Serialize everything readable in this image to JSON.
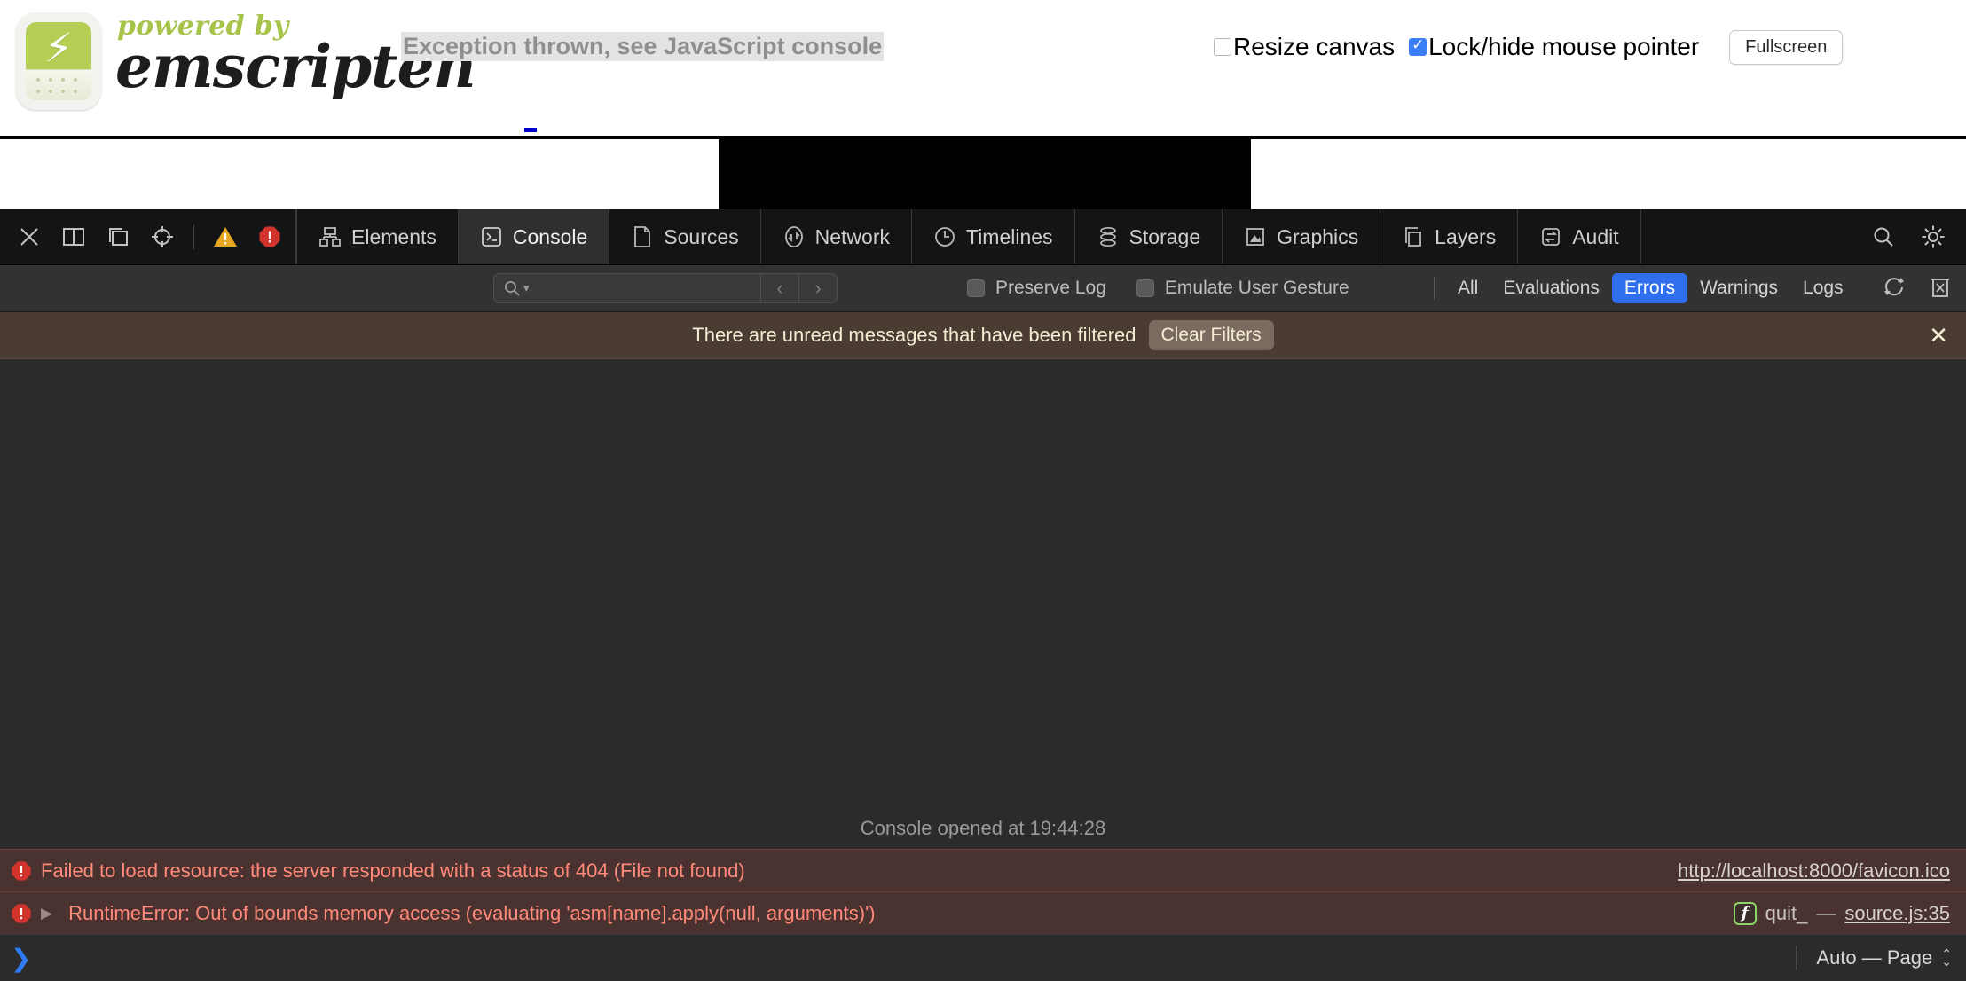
{
  "shell": {
    "logo": {
      "powered_by": "powered by",
      "wordmark": "emscripten",
      "bolt_glyph": "⚡"
    },
    "status_text": "Exception thrown, see JavaScript console",
    "controls": {
      "resize_canvas_label": "Resize canvas",
      "resize_canvas_checked": false,
      "pointer_lock_label": "Lock/hide mouse pointer",
      "pointer_lock_checked": true,
      "fullscreen_label": "Fullscreen"
    }
  },
  "inspector": {
    "toolbar_icons": [
      {
        "name": "close-inspector",
        "glyph": "✕"
      },
      {
        "name": "dock-side",
        "glyph": "▯"
      },
      {
        "name": "dock-undock",
        "glyph": "❐"
      },
      {
        "name": "inspect-element",
        "glyph": "⨁"
      }
    ],
    "counters": {
      "warnings_icon": "warning-triangle",
      "errors_icon": "error-octagon"
    },
    "tabs": [
      {
        "label": "Elements",
        "icon": "elements-icon",
        "active": false
      },
      {
        "label": "Console",
        "icon": "console-icon",
        "active": true
      },
      {
        "label": "Sources",
        "icon": "sources-icon",
        "active": false
      },
      {
        "label": "Network",
        "icon": "network-icon",
        "active": false
      },
      {
        "label": "Timelines",
        "icon": "timelines-icon",
        "active": false
      },
      {
        "label": "Storage",
        "icon": "storage-icon",
        "active": false
      },
      {
        "label": "Graphics",
        "icon": "graphics-icon",
        "active": false
      },
      {
        "label": "Layers",
        "icon": "layers-icon",
        "active": false
      },
      {
        "label": "Audit",
        "icon": "audit-icon",
        "active": false
      }
    ],
    "right_icons": [
      {
        "name": "search-icon",
        "glyph": "search"
      },
      {
        "name": "settings-gear-icon",
        "glyph": "gear"
      }
    ],
    "filterbar": {
      "search_placeholder": "",
      "search_value": "",
      "prev_label": "‹",
      "next_label": "›",
      "preserve_log_label": "Preserve Log",
      "preserve_log_checked": false,
      "emulate_gesture_label": "Emulate User Gesture",
      "emulate_gesture_checked": false,
      "pills": [
        {
          "label": "All",
          "active": false
        },
        {
          "label": "Evaluations",
          "active": false
        },
        {
          "label": "Errors",
          "active": true
        },
        {
          "label": "Warnings",
          "active": false
        },
        {
          "label": "Logs",
          "active": false
        }
      ],
      "active_pill_color": "#2f6fed",
      "clear_on_reload_icon": "refresh-circular-arrows-icon",
      "clear_console_icon": "trash-clear-icon"
    },
    "notice": {
      "message": "There are unread messages that have been filtered",
      "button_label": "Clear Filters",
      "close_glyph": "✕",
      "background": "#4a3b33",
      "text_color": "#f3ecd2"
    },
    "console": {
      "opened_text": "Console opened at 19:44:28",
      "messages": [
        {
          "level": "error",
          "icon": "error-octagon-icon",
          "has_disclosure": false,
          "text": "Failed to load resource: the server responded with a status of 404 (File not found)",
          "source_link": "http://localhost:8000/favicon.ico",
          "badge": "",
          "fn_name": "",
          "location": ""
        },
        {
          "level": "error",
          "icon": "error-octagon-icon",
          "has_disclosure": true,
          "disclosure_glyph": "▶",
          "text": "RuntimeError: Out of bounds memory access (evaluating 'asm[name].apply(null, arguments)')",
          "source_link": "",
          "badge": "f",
          "fn_name": "quit_",
          "separator": "—",
          "location": "source.js:35"
        }
      ],
      "error_text_color": "#ff8a7a",
      "error_row_background": "#4a3230"
    },
    "prompt": {
      "chevron": "❯",
      "value": "",
      "scope_label": "Auto — Page",
      "stepper_up": "⌃",
      "stepper_down": "⌄"
    }
  }
}
